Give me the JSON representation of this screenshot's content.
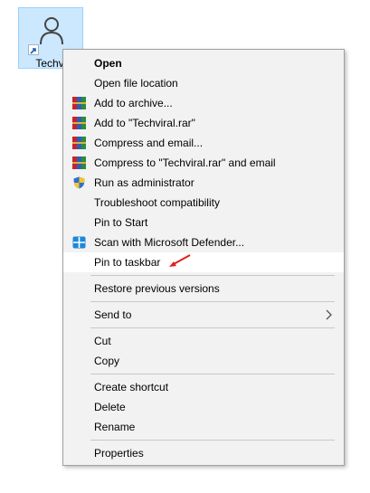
{
  "desktop_icon": {
    "label": "Techviral"
  },
  "menu": {
    "items": [
      {
        "label": "Open",
        "bold": true
      },
      {
        "label": "Open file location"
      },
      {
        "label": "Add to archive...",
        "icon": "winrar-icon"
      },
      {
        "label": "Add to \"Techviral.rar\"",
        "icon": "winrar-icon"
      },
      {
        "label": "Compress and email...",
        "icon": "winrar-icon"
      },
      {
        "label": "Compress to \"Techviral.rar\" and email",
        "icon": "winrar-icon"
      },
      {
        "label": "Run as administrator",
        "icon": "uac-shield-icon"
      },
      {
        "label": "Troubleshoot compatibility"
      },
      {
        "label": "Pin to Start"
      },
      {
        "label": "Scan with Microsoft Defender...",
        "icon": "defender-icon"
      },
      {
        "label": "Pin to taskbar",
        "highlighted": true
      },
      {
        "label": "Restore previous versions"
      },
      {
        "label": "Send to",
        "submenu": true
      },
      {
        "label": "Cut"
      },
      {
        "label": "Copy"
      },
      {
        "label": "Create shortcut"
      },
      {
        "label": "Delete"
      },
      {
        "label": "Rename"
      },
      {
        "label": "Properties"
      }
    ]
  },
  "colors": {
    "menu_bg": "#f2f2f2",
    "highlight_bg": "#ffffff",
    "selection_bg": "#cce8ff",
    "annotation": "#e02020"
  }
}
